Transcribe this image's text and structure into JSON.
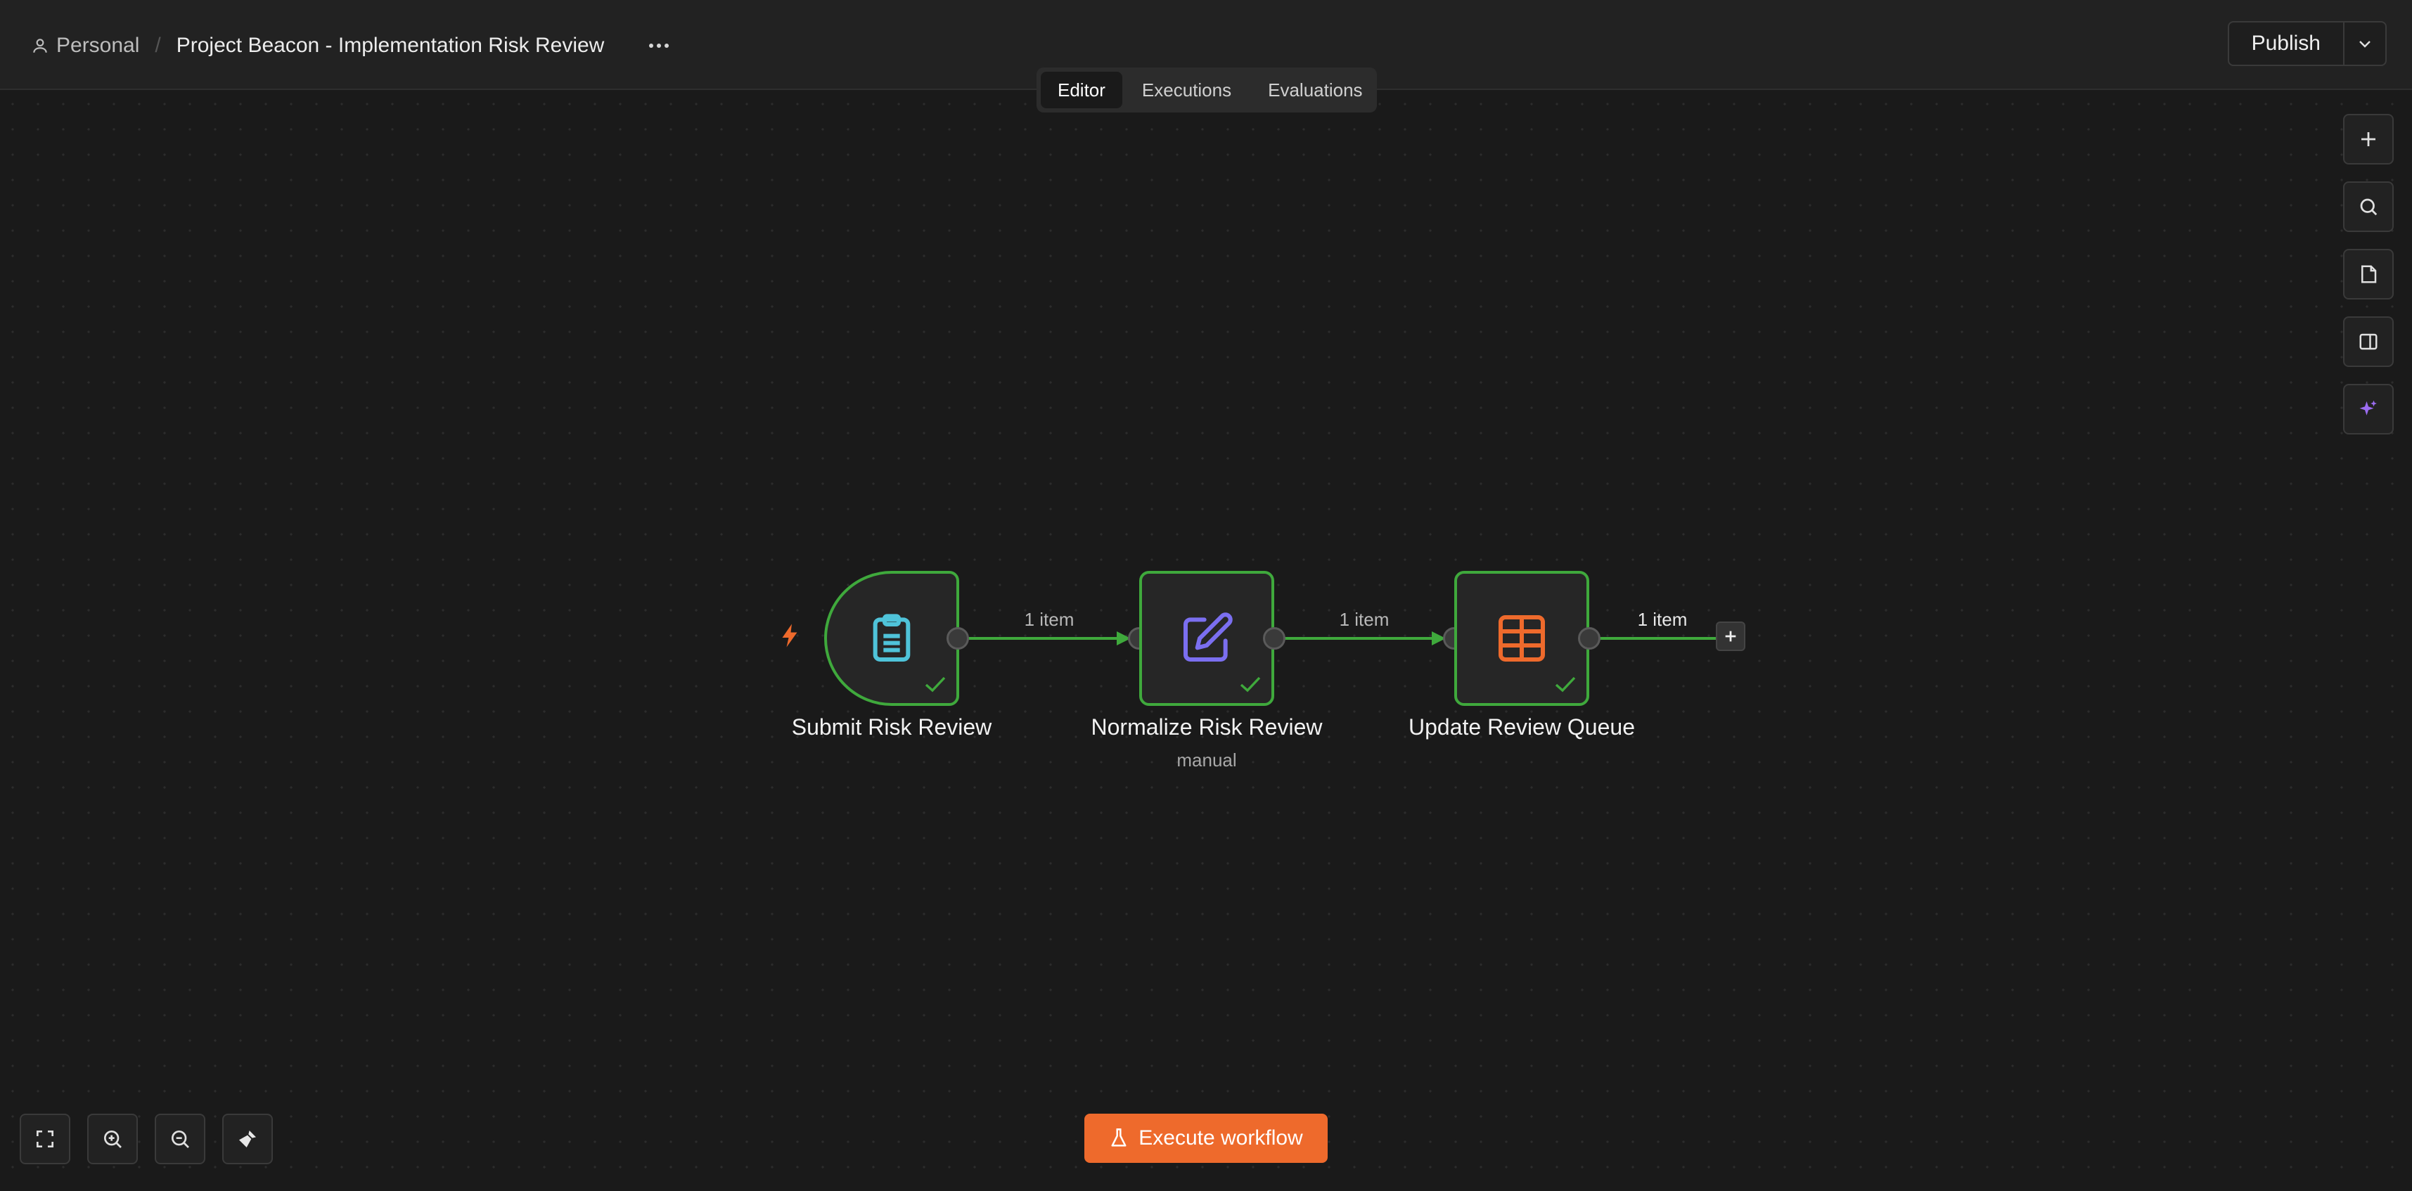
{
  "header": {
    "project": "Personal",
    "separator": "/",
    "workflow_title": "Project Beacon - Implementation Risk Review",
    "publish_label": "Publish"
  },
  "tabs": [
    {
      "label": "Editor",
      "active": true
    },
    {
      "label": "Executions",
      "active": false
    },
    {
      "label": "Evaluations",
      "active": false
    }
  ],
  "workflow": {
    "nodes": [
      {
        "label": "Submit Risk Review",
        "subtitle": "",
        "icon": "clipboard-icon",
        "color": "#4fc3d9",
        "status": "success"
      },
      {
        "label": "Normalize Risk Review",
        "subtitle": "manual",
        "icon": "edit-icon",
        "color": "#7b6ff0",
        "status": "success"
      },
      {
        "label": "Update Review Queue",
        "subtitle": "",
        "icon": "table-icon",
        "color": "#ee6a2c",
        "status": "success"
      }
    ],
    "edges": [
      {
        "label": "1 item"
      },
      {
        "label": "1 item"
      },
      {
        "label": "1 item"
      }
    ]
  },
  "execute_label": "Execute workflow",
  "colors": {
    "success": "#3fa93c",
    "accent": "#ee6a2c",
    "ai": "#9b6cf0"
  }
}
